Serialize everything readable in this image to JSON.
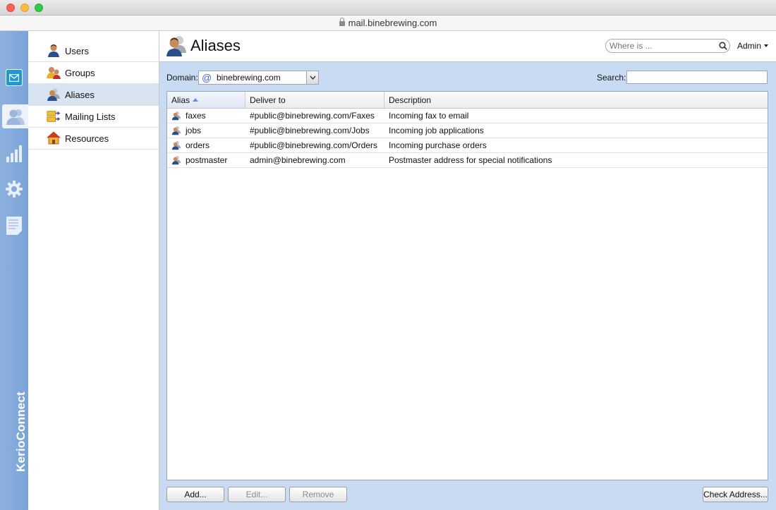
{
  "browser": {
    "url": "mail.binebrewing.com"
  },
  "brand": {
    "name": "KerioConnect"
  },
  "rail": [
    {
      "name": "mail-icon"
    },
    {
      "name": "accounts-icon"
    },
    {
      "name": "statistics-icon"
    },
    {
      "name": "settings-icon"
    },
    {
      "name": "logs-icon"
    }
  ],
  "nav": {
    "items": [
      {
        "label": "Users",
        "icon": "user-icon"
      },
      {
        "label": "Groups",
        "icon": "group-icon"
      },
      {
        "label": "Aliases",
        "icon": "alias-icon",
        "active": true
      },
      {
        "label": "Mailing Lists",
        "icon": "mailing-list-icon"
      },
      {
        "label": "Resources",
        "icon": "house-icon"
      }
    ]
  },
  "header": {
    "title": "Aliases",
    "search_placeholder": "Where is ...",
    "user_menu": "Admin"
  },
  "toolbar": {
    "domain_label": "Domain:",
    "domain_value": "binebrewing.com",
    "search_label": "Search:"
  },
  "table": {
    "columns": [
      "Alias",
      "Deliver to",
      "Description"
    ],
    "sorted_column": "Alias",
    "rows": [
      {
        "alias": "faxes",
        "deliver_to": "#public@binebrewing.com/Faxes",
        "description": "Incoming fax to email"
      },
      {
        "alias": "jobs",
        "deliver_to": "#public@binebrewing.com/Jobs",
        "description": "Incoming job applications"
      },
      {
        "alias": "orders",
        "deliver_to": "#public@binebrewing.com/Orders",
        "description": "Incoming purchase orders"
      },
      {
        "alias": "postmaster",
        "deliver_to": "admin@binebrewing.com",
        "description": "Postmaster address for special notifications"
      }
    ]
  },
  "buttons": {
    "add": "Add...",
    "edit": "Edit...",
    "remove": "Remove",
    "check_address": "Check Address..."
  },
  "colors": {
    "main_bg": "#c9daf3",
    "rail_bg": "#7aa3d8",
    "nav_active": "#d9e4f3",
    "mail_accent": "#1b9ad6"
  }
}
